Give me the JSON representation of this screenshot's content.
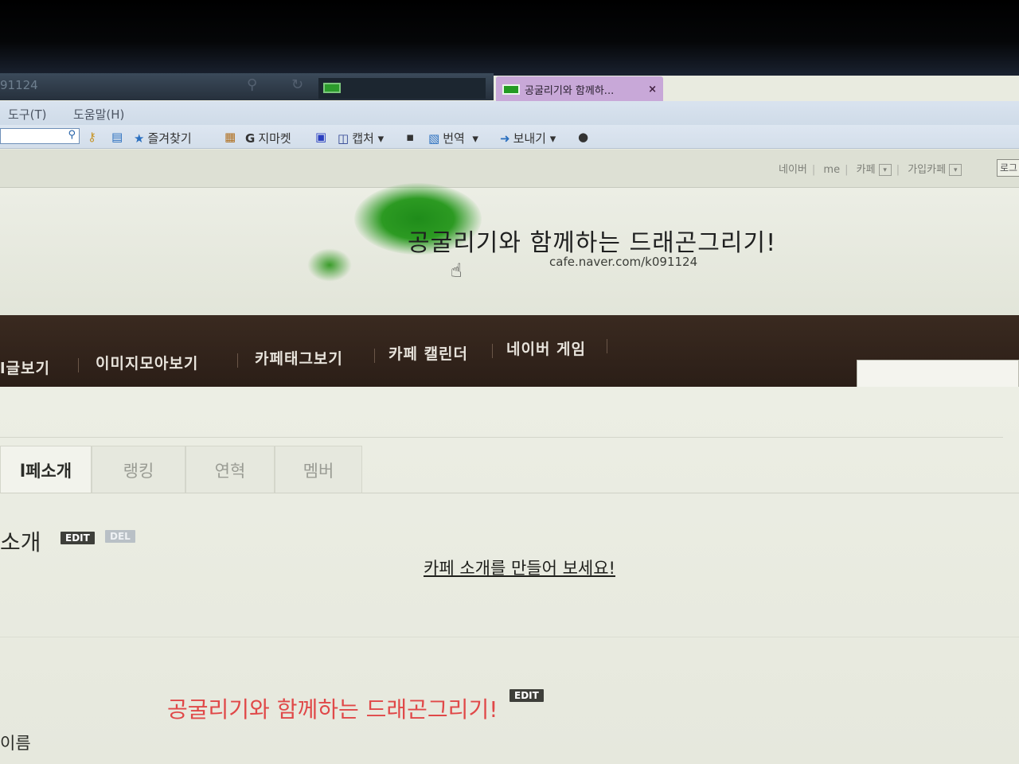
{
  "browser": {
    "address_fragment": "91124",
    "active_tab_title": "공굴리기와 함께하...",
    "active_tab_close": "×",
    "menu": [
      "도구(T)",
      "도움말(H)"
    ],
    "toolbar": {
      "favorites": "즐겨찾기",
      "gmarket": "지마켓",
      "gmarket_logo": "G",
      "capture": "캡처",
      "translate": "번역",
      "send": "보내기"
    }
  },
  "site_links": {
    "naver": "네이버",
    "me": "me",
    "cafe": "카페",
    "joined_cafe": "가입카페",
    "login": "로그"
  },
  "header": {
    "title": "공굴리기와 함께하는 드래곤그리기!",
    "url": "cafe.naver.com/k091124"
  },
  "nav": {
    "items": [
      "l글보기",
      "이미지모아보기",
      "카페태그보기",
      "카페 캘린더",
      "네이버 게임"
    ]
  },
  "subtabs": {
    "items": [
      "l페소개",
      "랭킹",
      "연혁",
      "멤버"
    ],
    "active_index": 0
  },
  "intro": {
    "title": "소개",
    "edit_label": "EDIT",
    "del_label": "DEL",
    "empty_link": "카페 소개를 만들어 보세요!"
  },
  "name_field": {
    "label": "이름",
    "value": "공굴리기와 함께하는 드래곤그리기!",
    "edit_label": "EDIT"
  }
}
